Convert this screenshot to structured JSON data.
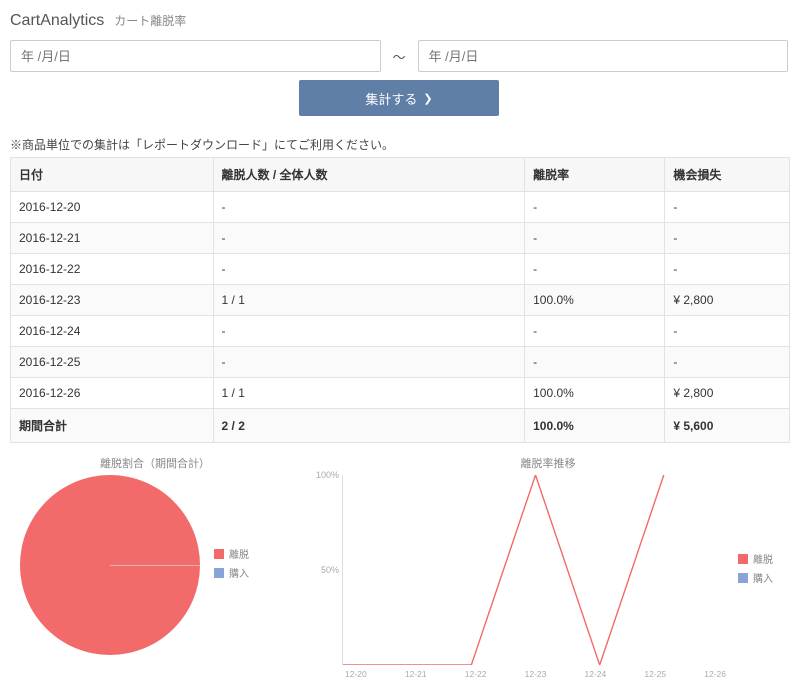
{
  "header": {
    "app_name": "CartAnalytics",
    "page_title": "カート離脱率"
  },
  "filter": {
    "date_from_placeholder": "年 /月/日",
    "date_to_placeholder": "年 /月/日",
    "tilde": "〜",
    "aggregate_label": "集計する"
  },
  "note": "※商品単位での集計は「レポートダウンロード」にてご利用ください。",
  "table": {
    "headers": {
      "date": "日付",
      "count": "離脱人数 / 全体人数",
      "rate": "離脱率",
      "loss": "機会損失"
    },
    "rows": [
      {
        "date": "2016-12-20",
        "count": "-",
        "rate": "-",
        "loss": "-"
      },
      {
        "date": "2016-12-21",
        "count": "-",
        "rate": "-",
        "loss": "-"
      },
      {
        "date": "2016-12-22",
        "count": "-",
        "rate": "-",
        "loss": "-"
      },
      {
        "date": "2016-12-23",
        "count": "1 / 1",
        "rate": "100.0%",
        "loss": "¥ 2,800"
      },
      {
        "date": "2016-12-24",
        "count": "-",
        "rate": "-",
        "loss": "-"
      },
      {
        "date": "2016-12-25",
        "count": "-",
        "rate": "-",
        "loss": "-"
      },
      {
        "date": "2016-12-26",
        "count": "1 / 1",
        "rate": "100.0%",
        "loss": "¥ 2,800"
      }
    ],
    "total": {
      "date": "期間合計",
      "count": "2 / 2",
      "rate": "100.0%",
      "loss": "¥ 5,600"
    }
  },
  "legend": {
    "exit": "離脱",
    "purchase": "購入"
  },
  "chart_data": [
    {
      "type": "pie",
      "title": "離脱割合（期間合計）",
      "series": [
        {
          "name": "離脱",
          "value": 100,
          "color": "#f26a6a"
        },
        {
          "name": "購入",
          "value": 0,
          "color": "#8aa3d6"
        }
      ]
    },
    {
      "type": "line",
      "title": "離脱率推移",
      "categories": [
        "12-20",
        "12-21",
        "12-22",
        "12-23",
        "12-24",
        "12-25",
        "12-26"
      ],
      "series": [
        {
          "name": "離脱",
          "color": "#f26a6a",
          "values": [
            0,
            0,
            0,
            100,
            0,
            100,
            null
          ]
        },
        {
          "name": "購入",
          "color": "#8aa3d6",
          "values": [
            null,
            null,
            null,
            null,
            null,
            null,
            null
          ]
        }
      ],
      "ylabel": "",
      "ylim": [
        0,
        100
      ],
      "yticks": [
        "50%",
        "100%"
      ]
    }
  ]
}
